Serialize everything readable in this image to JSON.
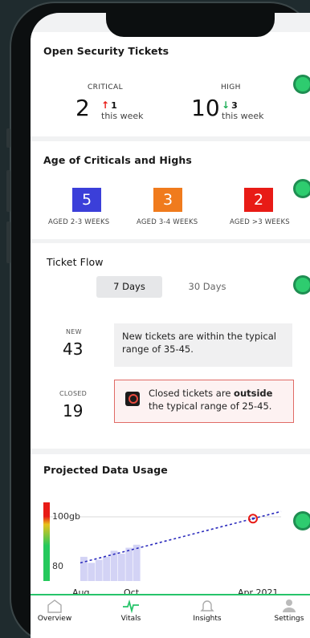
{
  "tickets": {
    "title": "Open Security Tickets",
    "critical": {
      "label": "CRITICAL",
      "count": "2",
      "delta": "1",
      "delta_sub": "this week",
      "direction": "up"
    },
    "high": {
      "label": "HIGH",
      "count": "10",
      "delta": "3",
      "delta_sub": "this week",
      "direction": "down"
    }
  },
  "age": {
    "title": "Age of Criticals and Highs",
    "buckets": [
      {
        "count": "5",
        "label": "AGED 2-3 WEEKS",
        "color": "#3b3fd9"
      },
      {
        "count": "3",
        "label": "AGED 3-4 WEEKS",
        "color": "#f07b1d"
      },
      {
        "count": "2",
        "label": "AGED >3 WEEKS",
        "color": "#e81b16"
      }
    ]
  },
  "flow": {
    "title": "Ticket Flow",
    "tabs": [
      "7 Days",
      "30 Days"
    ],
    "new_label": "NEW",
    "new_count": "43",
    "new_message": "New tickets are within the typical range of 35-45.",
    "closed_label": "CLOSED",
    "closed_count": "19",
    "closed_msg_pre": "Closed tickets are ",
    "closed_msg_bold": "outside",
    "closed_msg_post": " the typical range of 25-45."
  },
  "usage": {
    "title": "Projected Data Usage",
    "y_top_label": "100gb",
    "y_bottom_label": "80",
    "x_labels": [
      "Aug",
      "Oct",
      "Apr 2021"
    ]
  },
  "nav": {
    "items": [
      "Overview",
      "Vitals",
      "Insights",
      "Settings"
    ]
  },
  "colors": {
    "accent_green": "#27c46a",
    "red": "#e81b16",
    "green_arrow": "#1fae58"
  },
  "chart_data": {
    "type": "bar",
    "categories": [],
    "values": [
      86,
      84,
      85,
      86,
      88,
      87,
      89,
      90
    ],
    "trend": [
      {
        "x": 0,
        "y": 84
      },
      {
        "x": 1,
        "y": 101
      }
    ],
    "ylim": [
      78,
      104
    ]
  }
}
